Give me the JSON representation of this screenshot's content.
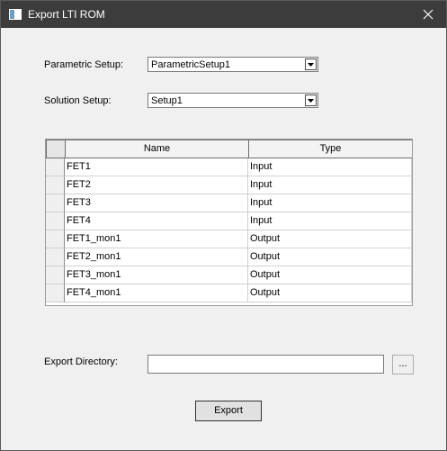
{
  "window": {
    "title": "Export LTI ROM",
    "close_symbol": "✕",
    "icon": "window-app-icon"
  },
  "form": {
    "parametric_label": "Parametric Setup:",
    "parametric_value": "ParametricSetup1",
    "solution_label": "Solution Setup:",
    "solution_value": "Setup1",
    "export_dir_label": "Export Directory:",
    "export_dir_value": "",
    "browse_label": "...",
    "export_label": "Export"
  },
  "grid": {
    "columns": [
      "Name",
      "Type"
    ],
    "rows": [
      {
        "name": "FET1",
        "type": "Input"
      },
      {
        "name": "FET2",
        "type": "Input"
      },
      {
        "name": "FET3",
        "type": "Input"
      },
      {
        "name": "FET4",
        "type": "Input"
      },
      {
        "name": "FET1_mon1",
        "type": "Output"
      },
      {
        "name": "FET2_mon1",
        "type": "Output"
      },
      {
        "name": "FET3_mon1",
        "type": "Output"
      },
      {
        "name": "FET4_mon1",
        "type": "Output"
      }
    ]
  }
}
